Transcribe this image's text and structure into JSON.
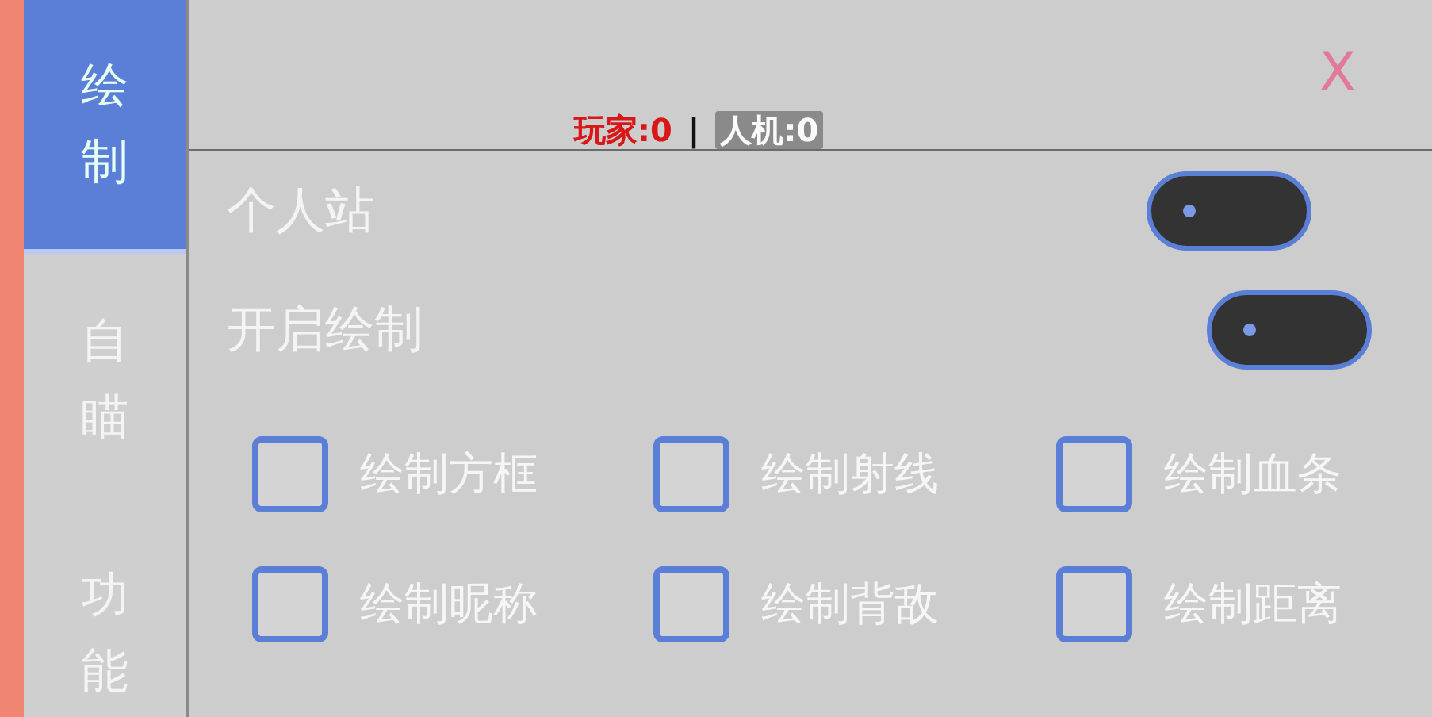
{
  "tabs": [
    {
      "label": "绘制",
      "selected": true
    },
    {
      "label": "自瞄",
      "selected": false
    },
    {
      "label": "功能",
      "selected": false
    }
  ],
  "close": "X",
  "status": {
    "players": "玩家:0",
    "separator": "|",
    "bots": "人机:0"
  },
  "toggles": [
    {
      "label": "个人站",
      "on": false
    },
    {
      "label": "开启绘制",
      "on": false
    }
  ],
  "checkboxes": [
    {
      "label": "绘制方框",
      "checked": false
    },
    {
      "label": "绘制射线",
      "checked": false
    },
    {
      "label": "绘制血条",
      "checked": false
    },
    {
      "label": "绘制昵称",
      "checked": false
    },
    {
      "label": "绘制背敌",
      "checked": false
    },
    {
      "label": "绘制距离",
      "checked": false
    }
  ]
}
